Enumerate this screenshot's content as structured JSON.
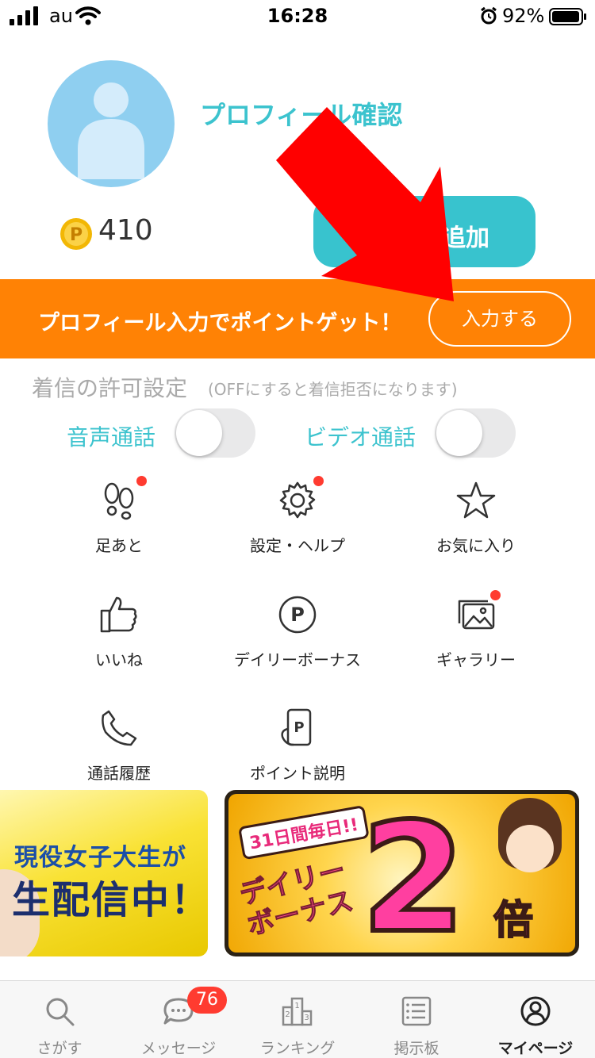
{
  "status_bar": {
    "carrier": "au",
    "time": "16:28",
    "battery": "92%"
  },
  "profile": {
    "link_label": "プロフィール確認",
    "points": "410",
    "add_button_label": "追加"
  },
  "banner": {
    "text": "プロフィール入力でポイントゲット！",
    "button_label": "入力する",
    "color": "#ff8205"
  },
  "call_settings": {
    "title": "着信の許可設定",
    "note": "(OFFにすると着信拒否になります)",
    "voice_label": "音声通話",
    "voice_on": false,
    "video_label": "ビデオ通話",
    "video_on": false
  },
  "menu": [
    {
      "label": "足あと",
      "icon": "footprints-icon",
      "notify": true
    },
    {
      "label": "設定・ヘルプ",
      "icon": "gear-icon",
      "notify": true
    },
    {
      "label": "お気に入り",
      "icon": "star-icon",
      "notify": false
    },
    {
      "label": "いいね",
      "icon": "thumbs-up-icon",
      "notify": false
    },
    {
      "label": "デイリーボーナス",
      "icon": "point-coin-icon",
      "notify": false
    },
    {
      "label": "ギャラリー",
      "icon": "gallery-icon",
      "notify": true
    },
    {
      "label": "通話履歴",
      "icon": "phone-icon",
      "notify": false
    },
    {
      "label": "ポイント説明",
      "icon": "point-phone-icon",
      "notify": false
    }
  ],
  "promos": {
    "left_line1": "現役女子大生が",
    "left_line2": "生配信中！",
    "right_days": "31日間毎日!!",
    "right_daily": "デイリー",
    "right_bonus": "ボーナス",
    "right_number": "2",
    "right_times": "倍"
  },
  "tabbar": {
    "items": [
      {
        "label": "さがす",
        "icon": "search-icon"
      },
      {
        "label": "メッセージ",
        "icon": "chat-icon"
      },
      {
        "label": "ランキング",
        "icon": "ranking-icon"
      },
      {
        "label": "掲示板",
        "icon": "board-icon"
      },
      {
        "label": "マイページ",
        "icon": "user-circle-icon"
      }
    ],
    "message_badge": "76",
    "active_index": 4
  },
  "colors": {
    "accent": "#3cc3ce",
    "banner": "#ff8205",
    "badge": "#ff3b30",
    "arrow": "#ff0000"
  }
}
